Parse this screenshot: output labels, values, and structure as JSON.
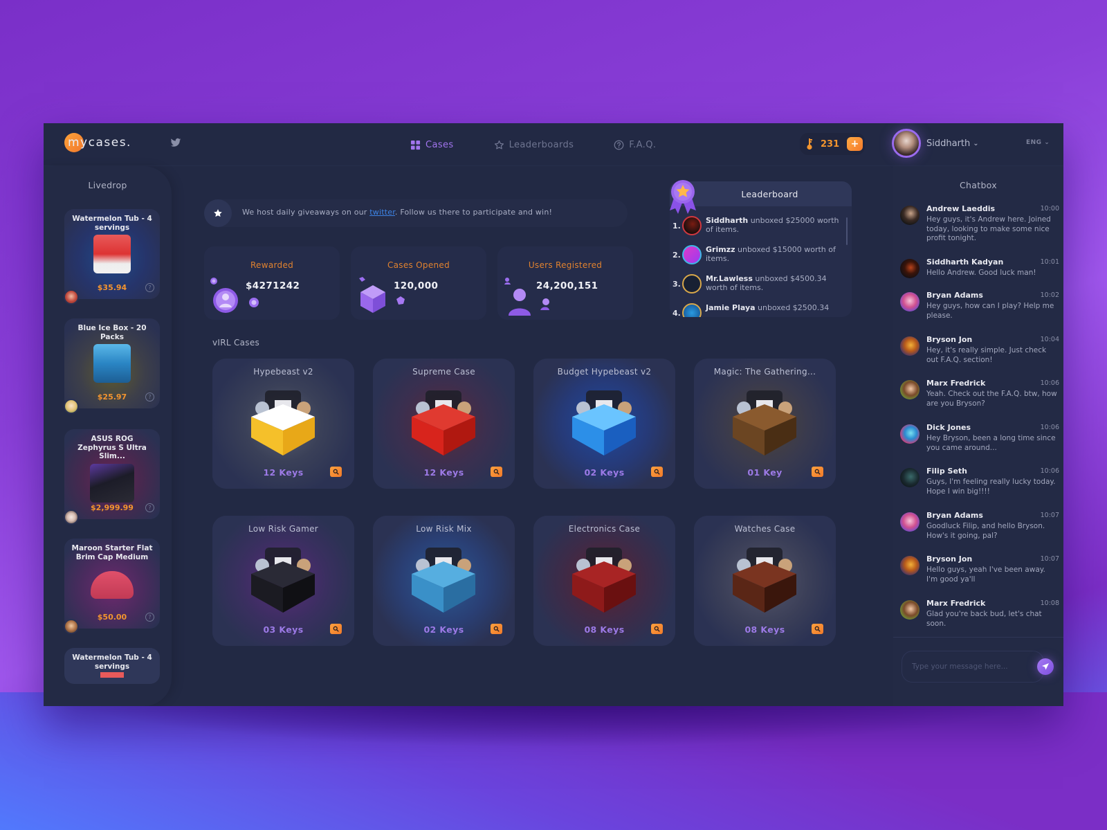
{
  "colors": {
    "accent_purple": "#a275ee",
    "accent_orange": "#f3952e",
    "link_blue": "#3d84e6",
    "panel_bg": "#222944"
  },
  "header": {
    "logo_text": "mycases.",
    "social_icon": "twitter-icon",
    "nav": [
      {
        "label": "Cases",
        "icon": "grid-icon",
        "active": true
      },
      {
        "label": "Leaderboards",
        "icon": "star-icon",
        "active": false
      },
      {
        "label": "F.A.Q.",
        "icon": "question-icon",
        "active": false
      }
    ],
    "coins": {
      "value": "231",
      "add_label": "+"
    },
    "user": {
      "name": "Siddharth",
      "chevron": "⌄"
    },
    "language": "ENG ⌄"
  },
  "livedrop": {
    "title": "Livedrop",
    "items": [
      {
        "name": "Watermelon Tub - 4 servings",
        "price": "$35.94",
        "help": "?"
      },
      {
        "name": "Blue Ice Box - 20 Packs",
        "price": "$25.97",
        "help": "?"
      },
      {
        "name": "ASUS ROG Zephyrus S Ultra Slim...",
        "price": "$2,999.99",
        "help": "?"
      },
      {
        "name": "Maroon Starter Flat Brim Cap Medium",
        "price": "$50.00",
        "help": "?"
      },
      {
        "name": "Watermelon Tub - 4 servings",
        "price": "",
        "help": ""
      }
    ]
  },
  "banner": {
    "text_before": "We host daily giveaways on our ",
    "link": "twitter",
    "text_after": ". Follow us there to participate and win!"
  },
  "stats": [
    {
      "label": "Rewarded",
      "value": "$4271242"
    },
    {
      "label": "Cases Opened",
      "value": "120,000"
    },
    {
      "label": "Users Registered",
      "value": "24,200,151"
    }
  ],
  "leaderboard": {
    "title": "Leaderboard",
    "entries": [
      {
        "rank": "1.",
        "name": "Siddharth",
        "text": " unboxed $25000 worth of items."
      },
      {
        "rank": "2.",
        "name": "Grimzz",
        "text": " unboxed $15000 worth of items."
      },
      {
        "rank": "3.",
        "name": "Mr.Lawless",
        "text": " unboxed $4500.34 worth of items."
      },
      {
        "rank": "4.",
        "name": "Jamie Playa",
        "text": " unboxed $2500.34"
      }
    ]
  },
  "cases": {
    "title": "vIRL Cases",
    "items": [
      {
        "name": "Hypebeast v2",
        "keys": "12 Keys"
      },
      {
        "name": "Supreme Case",
        "keys": "12 Keys"
      },
      {
        "name": "Budget Hypebeast v2",
        "keys": "02 Keys"
      },
      {
        "name": "Magic: The Gathering...",
        "keys": "01 Key"
      },
      {
        "name": "Low Risk Gamer",
        "keys": "03 Keys"
      },
      {
        "name": "Low Risk Mix",
        "keys": "02 Keys"
      },
      {
        "name": "Electronics Case",
        "keys": "08 Keys"
      },
      {
        "name": "Watches Case",
        "keys": "08 Keys"
      }
    ]
  },
  "chat": {
    "title": "Chatbox",
    "messages": [
      {
        "name": "Andrew Laeddis",
        "time": "10:00",
        "text": "Hey guys, it's Andrew here. Joined today, looking to make some nice profit tonight."
      },
      {
        "name": "Siddharth Kadyan",
        "time": "10:01",
        "text": "Hello Andrew. Good luck man!"
      },
      {
        "name": "Bryan Adams",
        "time": "10:02",
        "text": "Hey guys, how can I play? Help me please."
      },
      {
        "name": "Bryson Jon",
        "time": "10:04",
        "text": "Hey, it's really simple. Just check out F.A.Q. section!"
      },
      {
        "name": "Marx Fredrick",
        "time": "10:06",
        "text": "Yeah. Check out the F.A.Q. btw, how are you Bryson?"
      },
      {
        "name": "Dick Jones",
        "time": "10:06",
        "text": "Hey Bryson, been a long time since you came around..."
      },
      {
        "name": "Filip Seth",
        "time": "10:06",
        "text": "Guys, I'm feeling really lucky today. Hope I win big!!!!"
      },
      {
        "name": "Bryan Adams",
        "time": "10:07",
        "text": "Goodluck Filip, and hello Bryson. How's it going, pal?"
      },
      {
        "name": "Bryson Jon",
        "time": "10:07",
        "text": "Hello guys, yeah I've been away. I'm good ya'll"
      },
      {
        "name": "Marx Fredrick",
        "time": "10:08",
        "text": "Glad you're back bud, let's chat soon."
      }
    ],
    "input_placeholder": "Type your message here...",
    "input_value": ""
  }
}
